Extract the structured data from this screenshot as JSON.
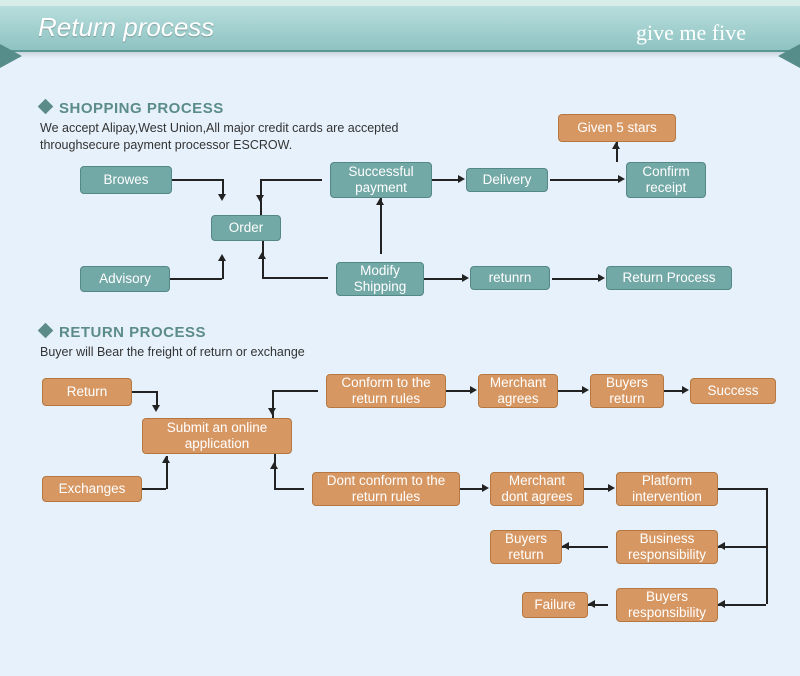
{
  "banner": {
    "title": "Return process",
    "tag": "give me five"
  },
  "section1": {
    "heading": "SHOPPING PROCESS",
    "sub": "We accept Alipay,West Union,All major credit cards are accepted\nthroughsecure payment processor ESCROW."
  },
  "shop": {
    "browse": "Browes",
    "order": "Order",
    "advisory": "Advisory",
    "successfulPayment": "Successful payment",
    "modifyShipping": "Modify Shipping",
    "delivery": "Delivery",
    "return": "retunrn",
    "confirmReceipt": "Confirm receipt",
    "given5stars": "Given 5 stars",
    "returnProcess": "Return Process"
  },
  "section2": {
    "heading": "RETURN PROCESS",
    "sub": "Buyer will Bear the freight of return or exchange"
  },
  "ret": {
    "return": "Return",
    "submit": "Submit an online application",
    "exchanges": "Exchanges",
    "conform": "Conform to the return rules",
    "dontConform": "Dont conform to the return rules",
    "merchantAgrees": "Merchant agrees",
    "merchantDont": "Merchant dont agrees",
    "buyersReturn1": "Buyers return",
    "success": "Success",
    "platform": "Platform intervention",
    "businessResp": "Business responsibility",
    "buyersReturn2": "Buyers return",
    "buyersResp": "Buyers responsibility",
    "failure": "Failure"
  }
}
